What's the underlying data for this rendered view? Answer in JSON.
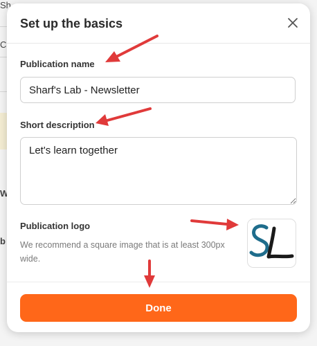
{
  "background": {
    "fragments": [
      "Sh",
      "C",
      "W",
      "b"
    ]
  },
  "modal": {
    "title": "Set up the basics",
    "close_icon": "close-icon",
    "publication_name": {
      "label": "Publication name",
      "value": "Sharf's Lab - Newsletter"
    },
    "short_description": {
      "label": "Short description",
      "value": "Let's learn together"
    },
    "publication_logo": {
      "label": "Publication logo",
      "help": "We recommend a square image that is at least 300px wide.",
      "logo_text": "SL"
    },
    "done_label": "Done"
  },
  "colors": {
    "accent": "#ff6719",
    "annotation_arrow": "#e03a3a",
    "logo_s": "#1f6d8c",
    "logo_l": "#1a1a1a"
  }
}
